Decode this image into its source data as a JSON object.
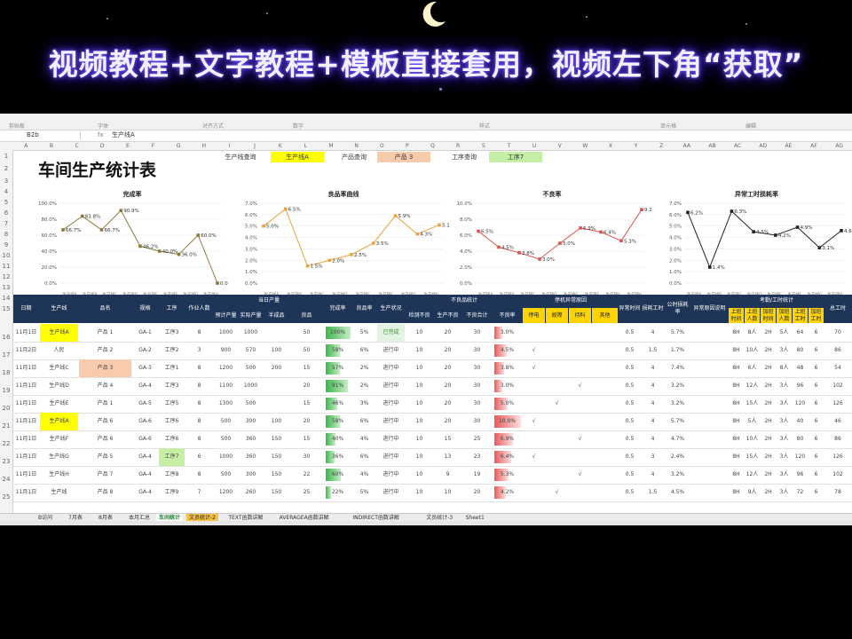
{
  "banner": {
    "text": "视频教程+文字教程+模板直接套用，视频左下角“获取”"
  },
  "ribbon": {
    "labels": [
      "剪贴板",
      "字体",
      "对齐方式",
      "数字",
      "样式",
      "单元格",
      "编辑"
    ]
  },
  "formula": {
    "cell_ref": "B2b",
    "fx": "fx",
    "value": "生产线A"
  },
  "columns": [
    "A",
    "B",
    "C",
    "D",
    "E",
    "F",
    "G",
    "H",
    "I",
    "J",
    "K",
    "L",
    "M",
    "N",
    "O",
    "P",
    "Q",
    "R",
    "S",
    "T",
    "U",
    "V",
    "W",
    "X",
    "Y",
    "Z",
    "AA",
    "AB",
    "AC",
    "AD",
    "AE",
    "AF",
    "AG"
  ],
  "rows": [
    "1",
    "2",
    "3",
    "4",
    "5",
    "6",
    "7",
    "8",
    "9",
    "10",
    "11",
    "12",
    "13",
    "14",
    "15",
    "16",
    "17",
    "18",
    "19",
    "20",
    "21",
    "22",
    "23",
    "24",
    "25"
  ],
  "sheet": {
    "title": "车间生产统计表",
    "queries": [
      {
        "label": "生产线查询",
        "value": "生产线A",
        "color": "#ffff00"
      },
      {
        "label": "产品查询",
        "value": "产品 3",
        "color": "#f8cbad"
      },
      {
        "label": "工序查询",
        "value": "工序7",
        "color": "#c6efa6"
      }
    ]
  },
  "chart_data": [
    {
      "type": "line",
      "title": "完成率",
      "categories": [
        "生产线A",
        "生产线B",
        "生产线C",
        "生产线D",
        "生产线E",
        "生产线F",
        "生产线G",
        "生产线H"
      ],
      "values": [
        66.7,
        83.8,
        66.7,
        90.9,
        46.2,
        40.0,
        36.0,
        60.0,
        0.0
      ],
      "labels": [
        "66.7%",
        "83.8%",
        "66.7%",
        "90.9%",
        "46.2%",
        "40.0%",
        "36.0%",
        "60.0%",
        "0.0%"
      ],
      "ylim": [
        0,
        100
      ],
      "yticks": [
        "0.0%",
        "20.0%",
        "40.0%",
        "60.0%",
        "80.0%",
        "100.0%"
      ],
      "color": "#8b7a3c"
    },
    {
      "type": "line",
      "title": "良品率曲线",
      "categories": [
        "生产线A",
        "生产线B",
        "生产线C",
        "生产线D",
        "生产线E",
        "生产线F",
        "生产线G",
        "生产线H"
      ],
      "values": [
        5.0,
        6.5,
        1.5,
        2.0,
        2.5,
        3.5,
        5.9,
        4.3,
        5.1
      ],
      "labels": [
        "5.0%",
        "6.5%",
        "1.5%",
        "2.0%",
        "2.5%",
        "3.5%",
        "5.9%",
        "4.3%",
        "5.1%"
      ],
      "ylim": [
        0,
        7
      ],
      "yticks": [
        "0.0%",
        "1.0%",
        "2.0%",
        "3.0%",
        "4.0%",
        "5.0%",
        "6.0%",
        "7.0%"
      ],
      "color": "#e8a33c"
    },
    {
      "type": "line",
      "title": "不良率",
      "categories": [
        "生产线A",
        "生产线B",
        "生产线C",
        "生产线D",
        "生产线E",
        "生产线F",
        "生产线G",
        "生产线H"
      ],
      "values": [
        6.5,
        4.5,
        3.8,
        3.0,
        5.0,
        6.9,
        6.4,
        5.3,
        9.2
      ],
      "labels": [
        "6.5%",
        "4.5%",
        "3.8%",
        "3.0%",
        "5.0%",
        "6.9%",
        "6.4%",
        "5.3%",
        "9.2%"
      ],
      "ylim": [
        0,
        10
      ],
      "yticks": [
        "0.0%",
        "2.0%",
        "4.0%",
        "6.0%",
        "8.0%",
        "10.0%"
      ],
      "color": "#d9534f"
    },
    {
      "type": "line",
      "title": "异常工时损耗率",
      "categories": [
        "生产线A",
        "生产线B",
        "生产线C",
        "生产线D",
        "生产线E",
        "生产线F",
        "生产线G",
        "生产线H"
      ],
      "values": [
        6.2,
        1.4,
        6.3,
        4.5,
        4.2,
        4.9,
        3.1,
        4.6
      ],
      "labels": [
        "6.2%",
        "1.4%",
        "6.3%",
        "4.5%",
        "4.2%",
        "4.9%",
        "3.1%",
        "4.6%"
      ],
      "ylim": [
        0,
        7
      ],
      "yticks": [
        "0.0%",
        "1.0%",
        "2.0%",
        "3.0%",
        "4.0%",
        "5.0%",
        "6.0%",
        "7.0%"
      ],
      "color": "#222222"
    }
  ],
  "table": {
    "groups": {
      "daily": "当日产量",
      "defect": "不良品统计",
      "equip": "停机异常原因",
      "labor": "考勤/工时统计"
    },
    "headers": {
      "date": "日期",
      "line": "生产线",
      "product": "品名",
      "spec": "规格",
      "process": "工序",
      "workers": "作业人数",
      "plan": "预计产量",
      "actual": "实际产量",
      "semi": "半成品",
      "good": "良品",
      "rate": "完成率",
      "yield": "良品率",
      "status": "生产状况",
      "d1": "检测不良",
      "d2": "生产不良",
      "d3": "不良合计",
      "d4": "不良率",
      "e1": "停电",
      "e2": "故障",
      "e3": "待料",
      "e4": "其他",
      "abn": "异常时间",
      "hrs": "损耗工时",
      "loss": "公时损耗率",
      "reason": "异常原因说明",
      "l1": "上班时间",
      "l2": "上班人数",
      "l3": "加班时间",
      "l4": "加班人数",
      "l5": "上班工时",
      "l6": "加班工时",
      "total": "总工时"
    },
    "rows": [
      {
        "date": "11月1日",
        "line": "生产线A",
        "product": "产品 1",
        "spec": "GA-1",
        "process": "工序3",
        "workers": "8",
        "plan": "1000",
        "actual": "1000",
        "semi": "",
        "good": "50",
        "rate": "100%",
        "rate_v": 100,
        "yield": "5%",
        "status": "已完成",
        "d1": "10",
        "d2": "20",
        "d3": "30",
        "d4": "3.0%",
        "d4_v": 3.0,
        "e1": "",
        "e2": "",
        "e3": "",
        "e4": "",
        "abn": "0.5",
        "hrs": "4",
        "loss": "5.7%",
        "l1": "8H",
        "l2": "8人",
        "l3": "2H",
        "l4": "5人",
        "l5": "64",
        "l6": "6",
        "total": "70",
        "hl_line": "yellow",
        "hl_product": "",
        "hl_process": ""
      },
      {
        "date": "11月2日",
        "line": "人民",
        "product": "产品 2",
        "spec": "GA-2",
        "process": "工序2",
        "workers": "3",
        "plan": "900",
        "actual": "570",
        "semi": "100",
        "good": "50",
        "rate": "58%",
        "rate_v": 58,
        "yield": "6%",
        "status": "进行中",
        "d1": "10",
        "d2": "20",
        "d3": "30",
        "d4": "4.5%",
        "d4_v": 4.5,
        "e1": "√",
        "e2": "",
        "e3": "",
        "e4": "",
        "abn": "0.5",
        "hrs": "1.5",
        "loss": "1.7%",
        "l1": "8H",
        "l2": "10人",
        "l3": "2H",
        "l4": "3人",
        "l5": "80",
        "l6": "6",
        "total": "86",
        "hl_line": "",
        "hl_product": "",
        "hl_process": ""
      },
      {
        "date": "11月1日",
        "line": "生产线C",
        "product": "产品 3",
        "spec": "GA-3",
        "process": "工序1",
        "workers": "8",
        "plan": "1200",
        "actual": "500",
        "semi": "200",
        "good": "15",
        "rate": "57%",
        "rate_v": 57,
        "yield": "2%",
        "status": "进行中",
        "d1": "10",
        "d2": "20",
        "d3": "30",
        "d4": "3.8%",
        "d4_v": 3.8,
        "e1": "√",
        "e2": "",
        "e3": "",
        "e4": "",
        "abn": "0.5",
        "hrs": "4",
        "loss": "7.4%",
        "l1": "8H",
        "l2": "6人",
        "l3": "2H",
        "l4": "8人",
        "l5": "48",
        "l6": "6",
        "total": "54",
        "hl_line": "",
        "hl_product": "peach",
        "hl_process": ""
      },
      {
        "date": "11月1日",
        "line": "生产线D",
        "product": "产品 4",
        "spec": "GA-4",
        "process": "工序3",
        "workers": "8",
        "plan": "1100",
        "actual": "1000",
        "semi": "",
        "good": "20",
        "rate": "91%",
        "rate_v": 91,
        "yield": "2%",
        "status": "进行中",
        "d1": "10",
        "d2": "20",
        "d3": "30",
        "d4": "3.0%",
        "d4_v": 3.0,
        "e1": "",
        "e2": "",
        "e3": "√",
        "e4": "",
        "abn": "0.5",
        "hrs": "4",
        "loss": "3.2%",
        "l1": "8H",
        "l2": "12人",
        "l3": "2H",
        "l4": "3人",
        "l5": "96",
        "l6": "6",
        "total": "102",
        "hl_line": "",
        "hl_product": "",
        "hl_process": ""
      },
      {
        "date": "11月1日",
        "line": "生产线E",
        "product": "产品 1",
        "spec": "GA-5",
        "process": "工序5",
        "workers": "8",
        "plan": "1300",
        "actual": "500",
        "semi": "",
        "good": "15",
        "rate": "46%",
        "rate_v": 46,
        "yield": "3%",
        "status": "进行中",
        "d1": "10",
        "d2": "20",
        "d3": "30",
        "d4": "5.0%",
        "d4_v": 5.0,
        "e1": "",
        "e2": "√",
        "e3": "",
        "e4": "",
        "abn": "0.5",
        "hrs": "4",
        "loss": "3.2%",
        "l1": "8H",
        "l2": "15人",
        "l3": "2H",
        "l4": "3人",
        "l5": "120",
        "l6": "6",
        "total": "126",
        "hl_line": "",
        "hl_product": "",
        "hl_process": ""
      },
      {
        "date": "11月1日",
        "line": "生产线A",
        "product": "产品 6",
        "spec": "GA-6",
        "process": "工序6",
        "workers": "8",
        "plan": "500",
        "actual": "300",
        "semi": "100",
        "good": "20",
        "rate": "58%",
        "rate_v": 58,
        "yield": "6%",
        "status": "进行中",
        "d1": "10",
        "d2": "20",
        "d3": "30",
        "d4": "10.0%",
        "d4_v": 10.0,
        "e1": "√",
        "e2": "",
        "e3": "",
        "e4": "",
        "abn": "0.5",
        "hrs": "4",
        "loss": "5.7%",
        "l1": "8H",
        "l2": "5人",
        "l3": "2H",
        "l4": "3人",
        "l5": "40",
        "l6": "6",
        "total": "46",
        "hl_line": "yellow",
        "hl_product": "",
        "hl_process": ""
      },
      {
        "date": "11月1日",
        "line": "生产线F",
        "product": "产品 6",
        "spec": "GA-6",
        "process": "工序6",
        "workers": "8",
        "plan": "500",
        "actual": "360",
        "semi": "150",
        "good": "15",
        "rate": "40%",
        "rate_v": 40,
        "yield": "4%",
        "status": "进行中",
        "d1": "10",
        "d2": "15",
        "d3": "25",
        "d4": "6.9%",
        "d4_v": 6.9,
        "e1": "",
        "e2": "",
        "e3": "√",
        "e4": "",
        "abn": "0.5",
        "hrs": "4",
        "loss": "4.7%",
        "l1": "8H",
        "l2": "10人",
        "l3": "2H",
        "l4": "3人",
        "l5": "80",
        "l6": "6",
        "total": "86",
        "hl_line": "",
        "hl_product": "",
        "hl_process": ""
      },
      {
        "date": "11月1日",
        "line": "生产线G",
        "product": "产品 5",
        "spec": "GA-4",
        "process": "工序7",
        "workers": "6",
        "plan": "1000",
        "actual": "360",
        "semi": "150",
        "good": "30",
        "rate": "36%",
        "rate_v": 36,
        "yield": "6%",
        "status": "进行中",
        "d1": "10",
        "d2": "13",
        "d3": "23",
        "d4": "6.4%",
        "d4_v": 6.4,
        "e1": "√",
        "e2": "",
        "e3": "",
        "e4": "",
        "abn": "0.5",
        "hrs": "3",
        "loss": "2.4%",
        "l1": "8H",
        "l2": "15人",
        "l3": "2H",
        "l4": "3人",
        "l5": "120",
        "l6": "6",
        "total": "126",
        "hl_line": "",
        "hl_product": "",
        "hl_process": "lime"
      },
      {
        "date": "11月1日",
        "line": "生产线H",
        "product": "产品 7",
        "spec": "GA-4",
        "process": "工序8",
        "workers": "8",
        "plan": "500",
        "actual": "300",
        "semi": "150",
        "good": "22",
        "rate": "60%",
        "rate_v": 60,
        "yield": "4%",
        "status": "进行中",
        "d1": "10",
        "d2": "9",
        "d3": "19",
        "d4": "5.3%",
        "d4_v": 5.3,
        "e1": "",
        "e2": "",
        "e3": "√",
        "e4": "",
        "abn": "0.5",
        "hrs": "4",
        "loss": "3.2%",
        "l1": "8H",
        "l2": "12人",
        "l3": "2H",
        "l4": "3人",
        "l5": "96",
        "l6": "6",
        "total": "102",
        "hl_line": "",
        "hl_product": "",
        "hl_process": ""
      },
      {
        "date": "11月1日",
        "line": "生产线",
        "product": "产品 8",
        "spec": "GA-4",
        "process": "工序9",
        "workers": "7",
        "plan": "1200",
        "actual": "260",
        "semi": "150",
        "good": "25",
        "rate": "22%",
        "rate_v": 22,
        "yield": "5%",
        "status": "进行中",
        "d1": "10",
        "d2": "10",
        "d3": "20",
        "d4": "4.2%",
        "d4_v": 4.2,
        "e1": "",
        "e2": "√",
        "e3": "",
        "e4": "",
        "abn": "0.5",
        "hrs": "1.5",
        "loss": "4.5%",
        "l1": "8H",
        "l2": "9人",
        "l3": "2H",
        "l4": "3人",
        "l5": "72",
        "l6": "6",
        "total": "78",
        "hl_line": "",
        "hl_product": "",
        "hl_process": ""
      }
    ]
  },
  "tabs": [
    "B访问",
    "7月表",
    "8月表",
    "本月汇总",
    "车间统计",
    "文员统计-2",
    "TEXT函数讲解",
    "AVERAGEA函数讲解",
    "INDIRECT函数讲解",
    "文员统计-3",
    "Sheet1"
  ],
  "active_tab": 4,
  "orange_tab": 5
}
